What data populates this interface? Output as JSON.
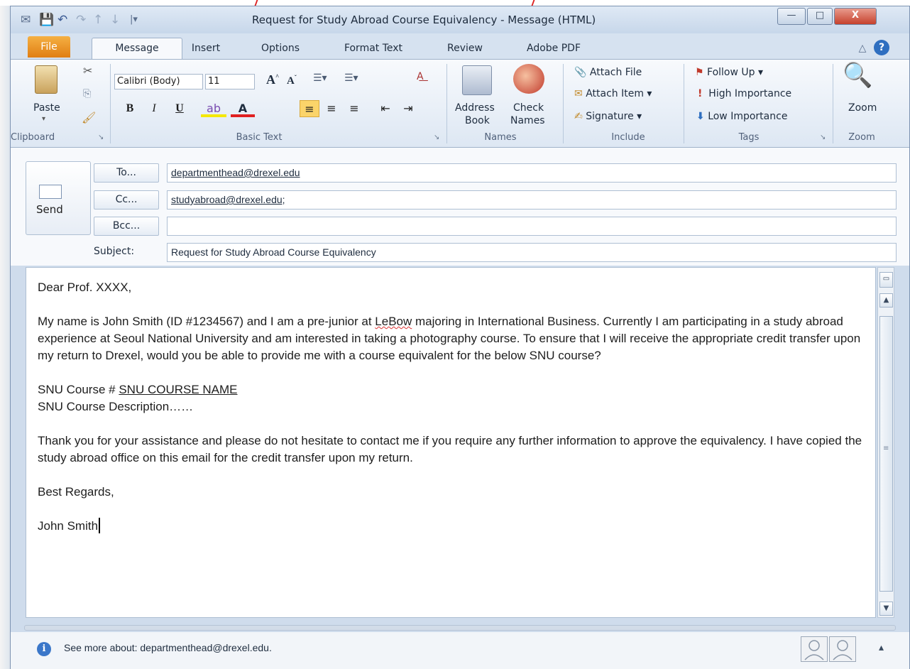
{
  "window": {
    "title": "Request for Study Abroad Course Equivalency  -  Message (HTML)",
    "controls": {
      "minimize": "—",
      "maximize": "□",
      "close": "X"
    }
  },
  "tabs": [
    "File",
    "Message",
    "Insert",
    "Options",
    "Format Text",
    "Review",
    "Adobe PDF"
  ],
  "ribbon": {
    "clipboard": {
      "paste": "Paste",
      "label": "Clipboard"
    },
    "basic_text": {
      "font_name": "Calibri (Body)",
      "font_size": "11",
      "bold": "B",
      "italic": "I",
      "underline": "U",
      "label": "Basic Text"
    },
    "names": {
      "address_book_1": "Address",
      "address_book_2": "Book",
      "check_names_1": "Check",
      "check_names_2": "Names",
      "label": "Names"
    },
    "include": {
      "attach_file": "Attach File",
      "attach_item": "Attach Item ▾",
      "signature": "Signature ▾",
      "label": "Include"
    },
    "tags": {
      "follow_up": "Follow Up ▾",
      "high_importance": "High Importance",
      "low_importance": "Low Importance",
      "label": "Tags"
    },
    "zoom": {
      "button": "Zoom",
      "label": "Zoom"
    }
  },
  "header": {
    "send": "Send",
    "to_label": "To...",
    "cc_label": "Cc...",
    "bcc_label": "Bcc...",
    "subject_label": "Subject:",
    "to_value": "departmenthead@drexel.edu",
    "cc_value": "studyabroad@drexel.edu;",
    "bcc_value": "",
    "subject_value": "Request for Study Abroad Course Equivalency"
  },
  "body": {
    "greeting": "Dear Prof. XXXX,",
    "para1_a": "My name is John Smith (ID #1234567)  and I am a pre-junior at ",
    "para1_lebow": "LeBow",
    "para1_b": " majoring in International Business.  Currently I am participating in a study abroad experience at Seoul National University and am interested in taking a photography course.  To ensure that I will receive the appropriate credit transfer upon my return to Drexel, would you be able to provide me with a course equivalent for the below SNU course?",
    "course_prefix": "SNU Course #  ",
    "course_name": "SNU COURSE NAME",
    "course_desc": "SNU Course Description……",
    "para3": "Thank you for your assistance and please do not hesitate to contact me if you require any further information to approve the equivalency.  I have copied the study abroad office on this email for the credit transfer upon my return.",
    "closing": "Best Regards,",
    "signature": "John Smith"
  },
  "people_pane": {
    "see_more": "See more about: departmenthead@drexel.edu."
  }
}
